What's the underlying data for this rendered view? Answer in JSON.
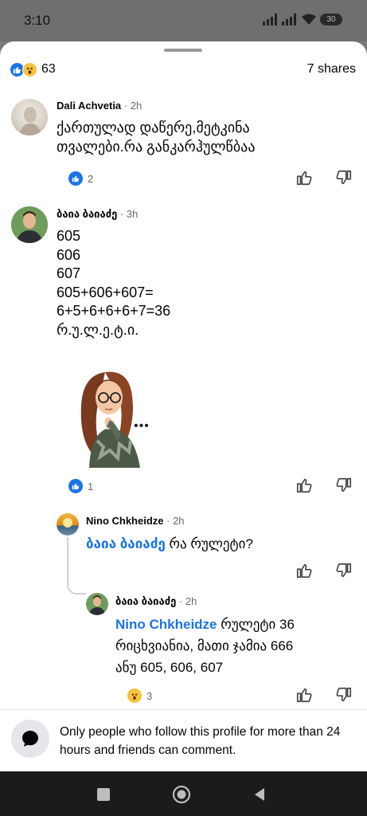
{
  "status_bar": {
    "time": "3:10",
    "battery": "30"
  },
  "post_stats": {
    "reaction_count": "63",
    "shares": "7 shares"
  },
  "comments": [
    {
      "author": "Dali  Achvetia",
      "time": "2h",
      "lines": [
        "ქართულად დაწერე,მეტკინა",
        "თვალები.რა განკარჰულწბაა"
      ],
      "reactions": "2",
      "reaction_type": "like"
    },
    {
      "author": "ბაია ბაიაძე",
      "time": "3h",
      "lines": [
        "605",
        "606",
        "607",
        "605+606+607=",
        "6+5+6+6+6+7=36",
        "რ.უ.ლ.ე.ტ.ი."
      ],
      "sticker_dots": "•••",
      "reactions": "1",
      "reaction_type": "like"
    }
  ],
  "replies": [
    {
      "author": "Nino Chkheidze",
      "time": "2h",
      "mention": "ბაია ბაიაძე",
      "text": " რა რულეტი?"
    },
    {
      "author": "ბაია ბაიაძე",
      "time": "2h",
      "mention": "Nino Chkheidze",
      "lines": [
        " რულეტი 36",
        "რიცხვიანია, მათი ჯამია 666",
        "ანუ 605, 606, 607"
      ],
      "reactions": "3",
      "reaction_type": "wow"
    }
  ],
  "footer": {
    "notice": "Only people who follow this profile for more than 24 hours and friends can comment."
  },
  "colors": {
    "accent": "#1b74e4",
    "wow": "#f7c33c",
    "text": "#050505",
    "meta": "#65676b"
  }
}
